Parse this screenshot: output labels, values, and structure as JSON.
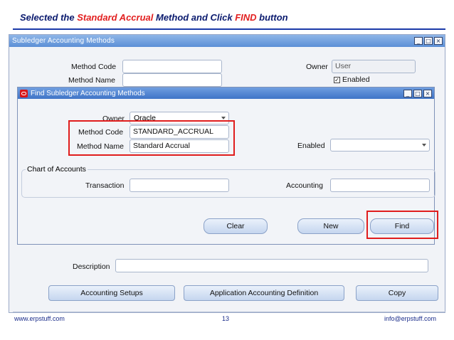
{
  "slide": {
    "title_prefix": "Selected the ",
    "title_highlight": "Standard Accrual",
    "title_middle": " Method and Click ",
    "title_highlight2": "FIND",
    "title_suffix": " button"
  },
  "outer_window": {
    "title": "Subledger Accounting Methods",
    "minimize": "_",
    "maximize": "□",
    "close": "×",
    "method_code_label": "Method Code",
    "method_code_value": "",
    "method_name_label": "Method Name",
    "method_name_value": "",
    "owner_label": "Owner",
    "owner_value": "User",
    "enabled_label": "Enabled",
    "enabled_checked": "✓",
    "description_label": "Description",
    "description_value": "",
    "accounting_setups_button": "Accounting Setups",
    "app_accounting_def_button": "Application Accounting Definition",
    "copy_button": "Copy"
  },
  "find_window": {
    "title": "Find Subledger Accounting Methods",
    "minimize": "_",
    "maximize": "□",
    "close": "×",
    "owner_label": "Owner",
    "owner_value": "Oracle",
    "method_code_label": "Method Code",
    "method_code_value": "STANDARD_ACCRUAL",
    "method_name_label": "Method Name",
    "method_name_value": "Standard Accrual",
    "enabled_label": "Enabled",
    "enabled_value": "",
    "chart_of_accounts_label": "Chart of Accounts",
    "transaction_label": "Transaction",
    "transaction_value": "",
    "accounting_label": "Accounting",
    "accounting_value": "",
    "clear_button": "Clear",
    "new_button": "New",
    "find_button": "Find"
  },
  "footer": {
    "left": "www.erpstuff.com",
    "page": "13",
    "right": "info@erpstuff.com"
  },
  "colors": {
    "highlight": "#e21f1f",
    "title_text": "#0a1a6e",
    "titlebar": "#5b8fd6"
  }
}
